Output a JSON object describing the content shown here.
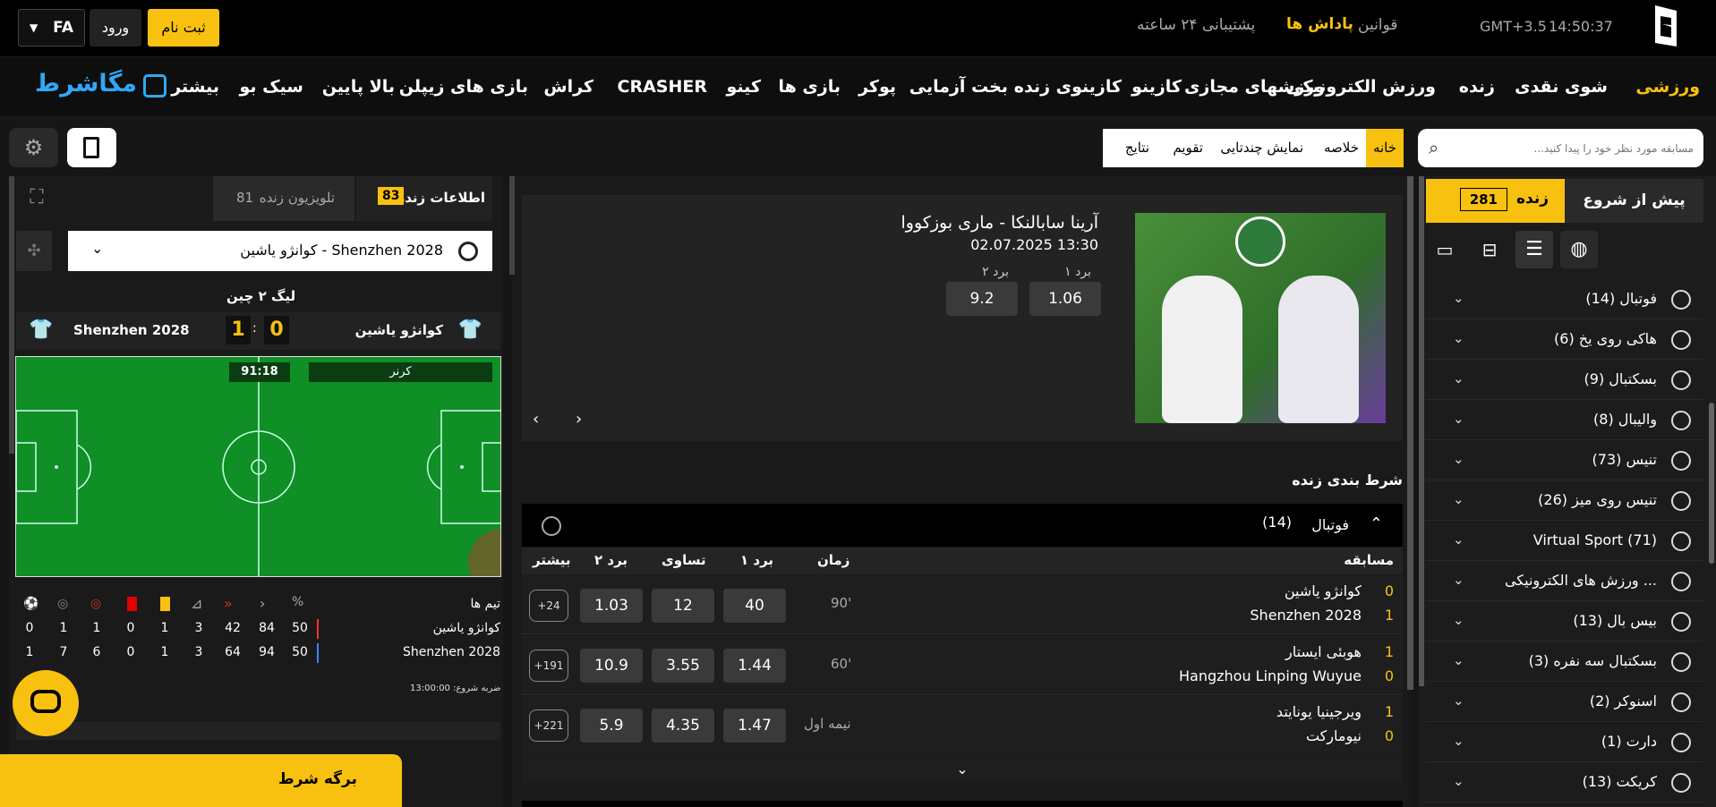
{
  "topbar": {
    "register": "ثبت نام",
    "login": "ورود",
    "lang": "FA",
    "rules": "قوانین",
    "bonuses": "پاداش ها",
    "support": "پشتیبانی ۲۴ ساعته",
    "timezone": "GMT+3.5",
    "time": "14:50:37"
  },
  "nav": {
    "items": [
      "ورزشی",
      "شوی نقدی",
      "زنده",
      "ورزش الکترونیکی",
      "ورزشهای مجازی",
      "کازینو",
      "کازینوی زنده",
      "بخت آزمایی",
      "پوکر",
      "بازی ها",
      "کینو",
      "CRASHER",
      "کراش",
      "بازی های زیپلن",
      "بالا پایین",
      "سیک بو",
      "بیشتر"
    ],
    "logo": "مگاشرط"
  },
  "search": {
    "placeholder": "مسابقه مورد نظر خود را پیدا کنید..."
  },
  "subtabs": [
    "خانه",
    "خلاصه",
    "نمایش چندتایی",
    "تقویم",
    "نتایج"
  ],
  "left_tabs": {
    "prematch": "پیش از شروع",
    "live": "زنده",
    "live_count": "281"
  },
  "sports": [
    {
      "label": "فوتبال (14)",
      "icon": "football-icon"
    },
    {
      "label": "هاکی روی یخ (6)",
      "icon": "hockey-icon"
    },
    {
      "label": "بسکتبال (9)",
      "icon": "basketball-icon"
    },
    {
      "label": "والیبال (8)",
      "icon": "volleyball-icon"
    },
    {
      "label": "تنیس (73)",
      "icon": "tennis-icon"
    },
    {
      "label": "تنیس روی میز (26)",
      "icon": "table-tennis-icon"
    },
    {
      "label": "Virtual Sport (71)",
      "icon": "virtual-sport-icon"
    },
    {
      "label": "ورزش های الکترونیکی ...",
      "icon": "esports-icon"
    },
    {
      "label": "بیس بال (13)",
      "icon": "baseball-icon"
    },
    {
      "label": "بسکتبال سه نفره (3)",
      "icon": "basketball-3x3-icon"
    },
    {
      "label": "اسنوکر (2)",
      "icon": "snooker-icon"
    },
    {
      "label": "دارت (1)",
      "icon": "darts-icon"
    },
    {
      "label": "کریکت (13)",
      "icon": "cricket-icon"
    }
  ],
  "banner": {
    "title": "آرینا سابالنکا - ماری بوزکووا",
    "datetime": "02.07.2025 13:30",
    "win1_label": "برد ۱",
    "win2_label": "برد ۲",
    "win1": "1.06",
    "win2": "9.2"
  },
  "live_betting": {
    "title": "شرط بندی زنده",
    "sport": "فوتبال",
    "count": "(14)",
    "headers": {
      "match": "مسابقه",
      "time": "زمان",
      "w1": "برد ۱",
      "draw": "تساوی",
      "w2": "برد ۲",
      "more": "بیشتر"
    },
    "rows": [
      {
        "team1": "کوانژو یاشین",
        "team2": "Shenzhen 2028",
        "s1": "0",
        "s2": "1",
        "time": "90'",
        "w1": "40",
        "draw": "12",
        "w2": "1.03",
        "more": "+24"
      },
      {
        "team1": "هوبئی ایستار",
        "team2": "Hangzhou Linping Wuyue",
        "s1": "1",
        "s2": "0",
        "time": "60'",
        "w1": "1.44",
        "draw": "3.55",
        "w2": "10.9",
        "more": "+191"
      },
      {
        "team1": "ویرجینیا یونایتد",
        "team2": "نیومارکت",
        "s1": "1",
        "s2": "0",
        "time": "نیمه اول",
        "w1": "1.47",
        "draw": "4.35",
        "w2": "5.9",
        "more": "+221"
      }
    ]
  },
  "right_panel": {
    "live_info": "اطلاعات زنده",
    "live_info_count": "83",
    "live_tv": "تلویزیون زنده",
    "live_tv_count": "81",
    "match_select": "کوانژو یاشین - Shenzhen 2028",
    "league": "لیگ ۲ چین",
    "home": "کوانژو یاشین",
    "away": "Shenzhen 2028",
    "home_score": "0",
    "away_score": "1",
    "clock": "91:18",
    "event": "کرنر",
    "teams_label": "تیم ها",
    "stats_home": [
      "50",
      "84",
      "42",
      "3",
      "1",
      "0",
      "1",
      "1",
      "0"
    ],
    "stats_away": [
      "50",
      "94",
      "64",
      "3",
      "1",
      "0",
      "6",
      "7",
      "1"
    ],
    "kickoff": "ضربه شروع: 13:00:00"
  },
  "betslip": "برگه شرط"
}
